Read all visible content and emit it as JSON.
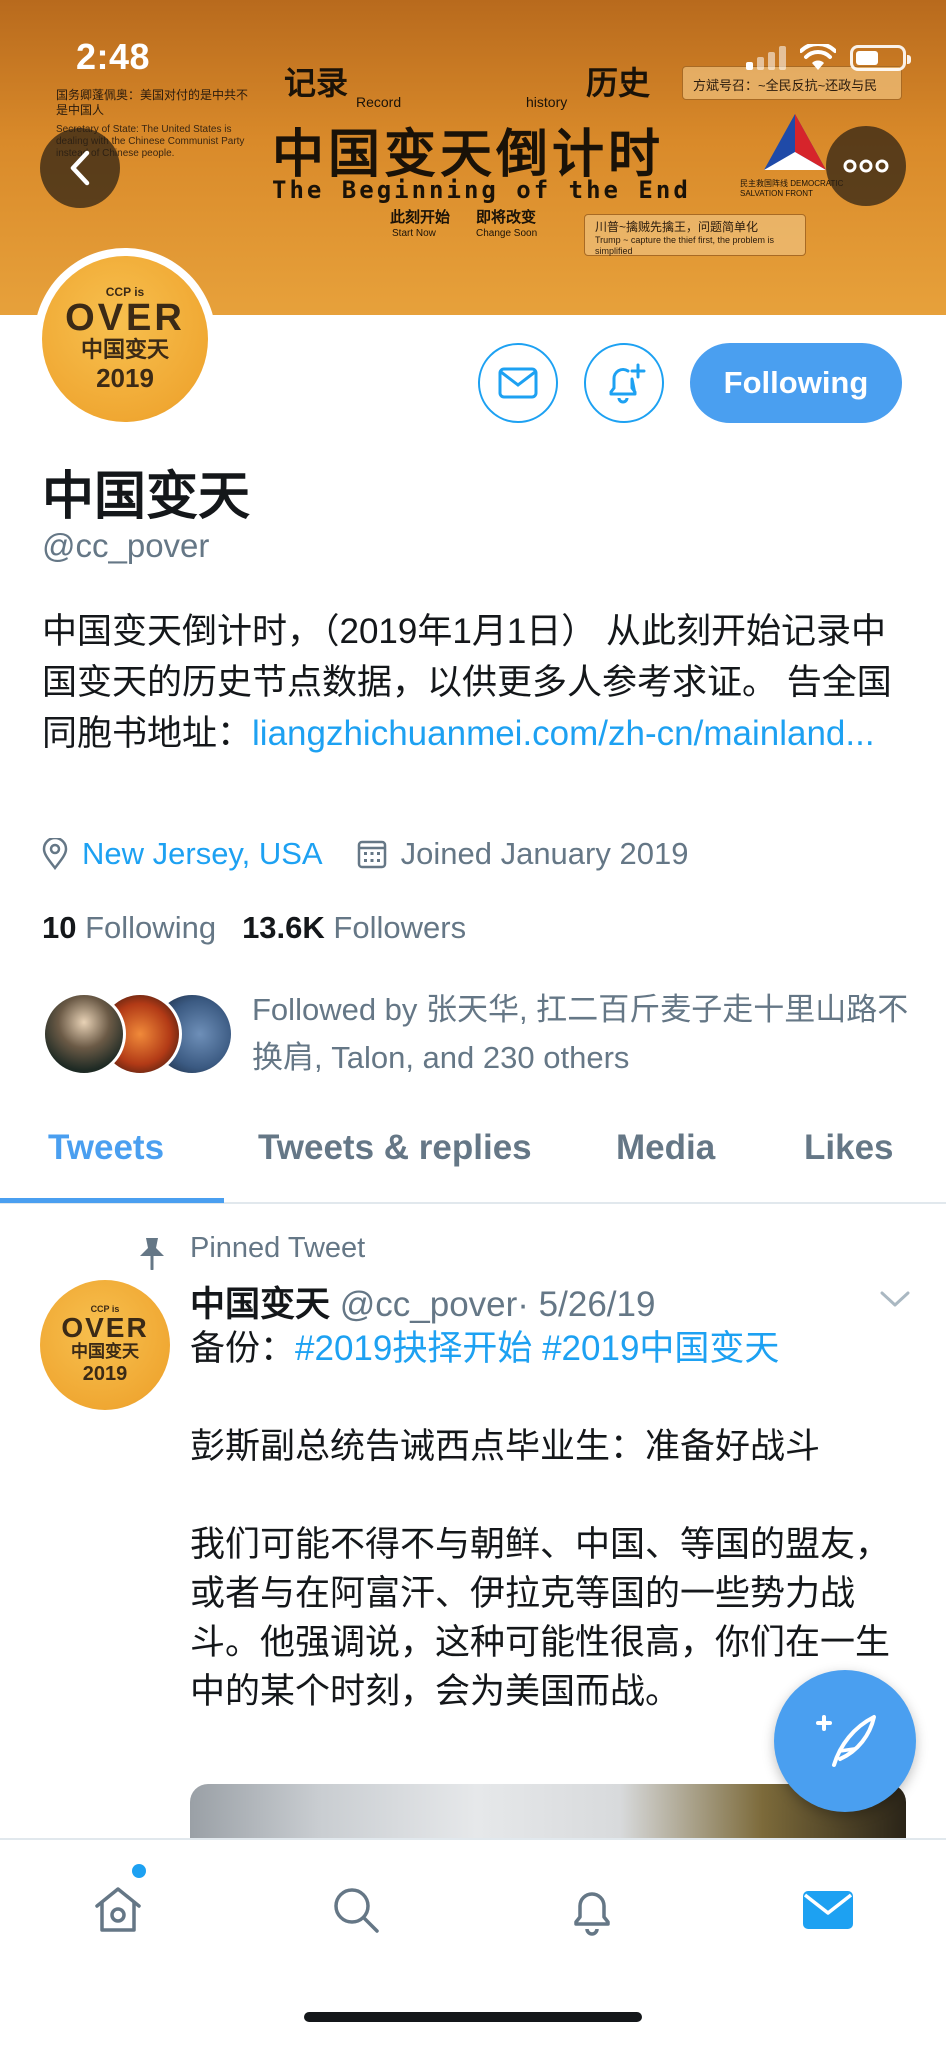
{
  "status_bar": {
    "time": "2:48"
  },
  "banner": {
    "left_cn": "国务卿蓬佩奥：美国对付的是中共不是中国人",
    "left_en": "Secretary of State: The United States is dealing with the Chinese Communist Party instead of Chinese people.",
    "record_cn": "记录",
    "record_en": "Record",
    "history_cn": "历史",
    "history_en": "history",
    "title_cn": "中国变天倒计时",
    "title_en": "The Beginning of the End",
    "start_cn": "此刻开始",
    "start_en": "Start Now",
    "change_cn": "即将改变",
    "change_en": "Change Soon",
    "tag_top": "方斌号召：~全民反抗~还政与民",
    "tag_bottom_cn": "川普~擒贼先擒王，问题简单化",
    "tag_bottom_en": "Trump ~ capture the thief first, the problem is simplified",
    "logo_text": "民主救国阵线 DEMOCRATIC SALVATION FRONT"
  },
  "avatar": {
    "ccp": "CCP is",
    "over": "OVER",
    "cn": "中国变天",
    "year": "2019"
  },
  "actions": {
    "follow_label": "Following"
  },
  "profile": {
    "name": "中国变天",
    "handle": "@cc_pover",
    "bio_text": "中国变天倒计时，（2019年1月1日） 从此刻开始记录中国变天的历史节点数据，以供更多人参考求证。 告全国同胞书地址：",
    "bio_link": "liangzhichuanmei.com/zh-cn/mainland...",
    "location": "New Jersey, USA",
    "joined": "Joined January 2019",
    "following_count": "10",
    "following_label": "Following",
    "followers_count": "13.6K",
    "followers_label": "Followers",
    "followed_by": "Followed by 张天华, 扛二百斤麦子走十里山路不换肩, Talon, and 230 others"
  },
  "tabs": [
    {
      "label": "Tweets"
    },
    {
      "label": "Tweets & replies"
    },
    {
      "label": "Media"
    },
    {
      "label": "Likes"
    }
  ],
  "tweet": {
    "pinned_label": "Pinned Tweet",
    "author_name": "中国变天",
    "author_handle": "@cc_pover",
    "date": "· 5/26/19",
    "backup_label": "备份：",
    "hashtag1": "#2019抉择开始",
    "hashtag2": "#2019中国变天",
    "para1": "彭斯副总统告诫西点毕业生：准备好战斗",
    "para2": "我们可能不得不与朝鲜、中国、等国的盟友，或者与在阿富汗、伊拉克等国的一些势力战斗。他强调说，这种可能性很高，你们在一生中的某个时刻，会为美国而战。"
  },
  "colors": {
    "accent": "#1da1f2",
    "follow_button": "#4a9ff0",
    "secondary_text": "#657786"
  },
  "bottom_nav": [
    "home-icon",
    "search-icon",
    "notifications-icon",
    "messages-icon"
  ]
}
